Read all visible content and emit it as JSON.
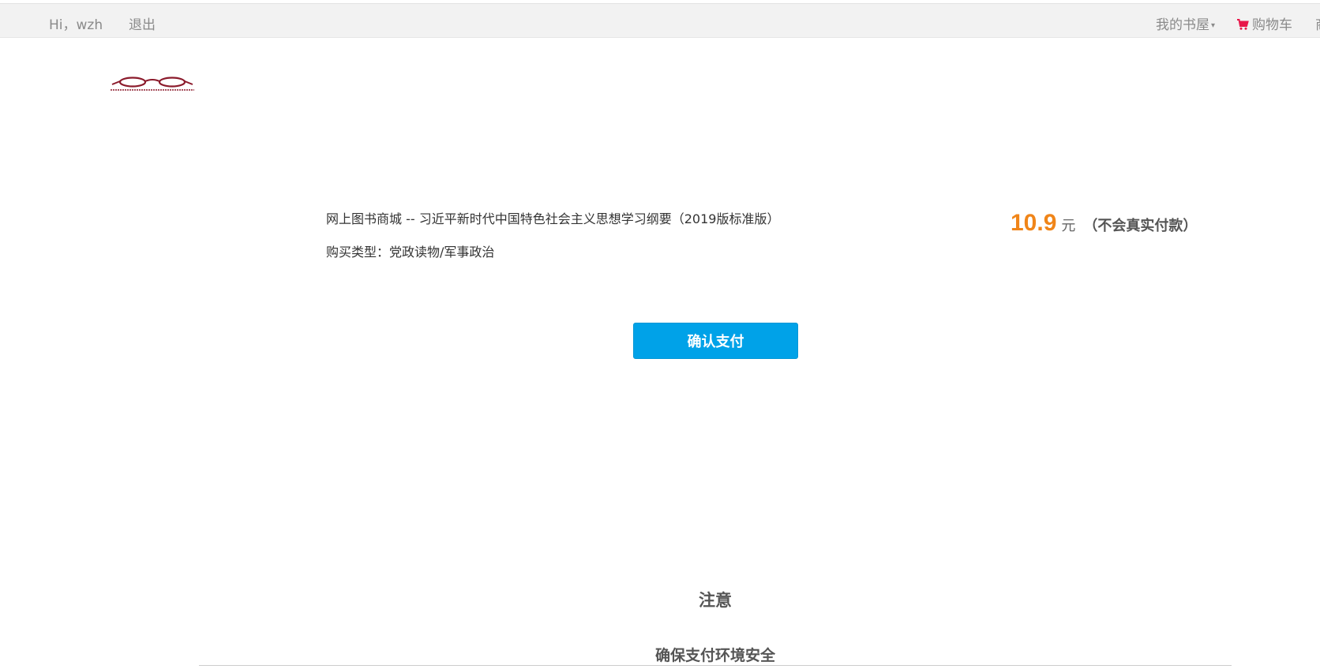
{
  "topbar": {
    "greeting": "Hi，wzh",
    "logout": "退出",
    "my_bookroom": "我的书屋",
    "cart": "购物车",
    "cutoff_text": "商"
  },
  "colors": {
    "accent": "#00a2e8",
    "price": "#f08519",
    "cart_icon": "#e8174a",
    "logo": "#8b1a2b"
  },
  "icons": {
    "cart": "shopping-cart-icon",
    "logo": "glasses-logo",
    "dropdown": "caret-down-icon"
  },
  "order": {
    "title": "网上图书商城 -- 习近平新时代中国特色社会主义思想学习纲要（2019版标准版）",
    "buy_type": "购买类型：党政读物/军事政治",
    "price": "10.9",
    "unit": "元",
    "note": "（不会真实付款）"
  },
  "confirm_button": "确认支付",
  "notice": {
    "heading": "注意",
    "sub": "确保支付环境安全"
  }
}
